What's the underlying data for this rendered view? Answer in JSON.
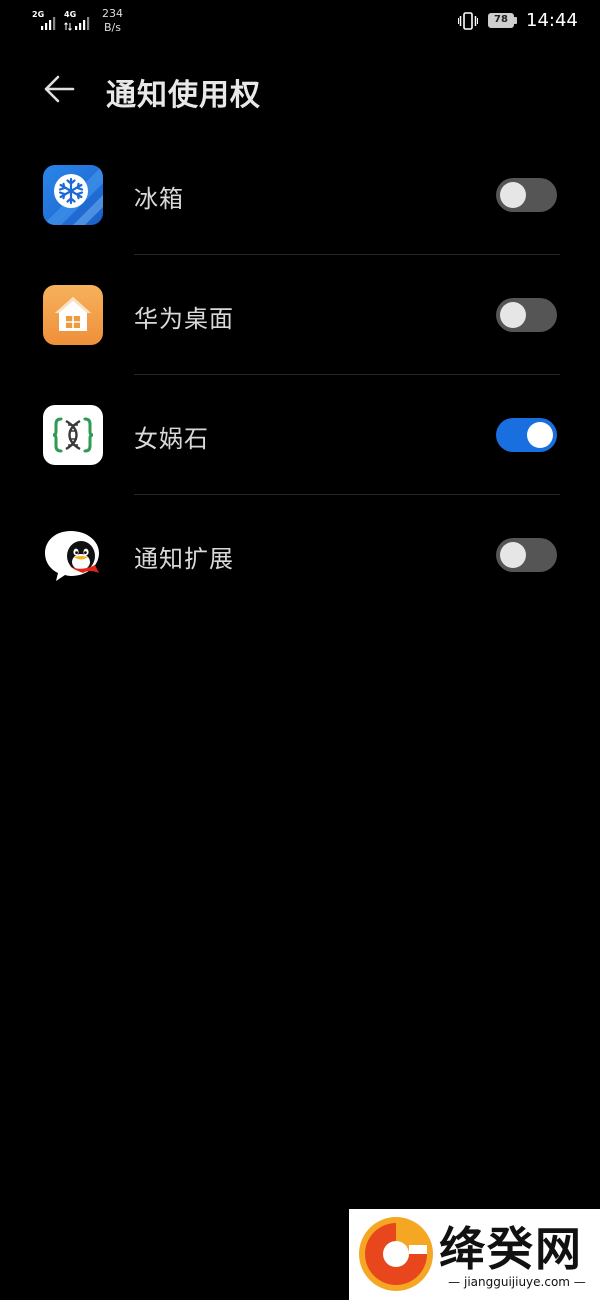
{
  "status_bar": {
    "signal_1": "2G",
    "signal_2": "4G",
    "speed_value": "234",
    "speed_unit": "B/s",
    "battery_level": "78",
    "time": "14:44"
  },
  "header": {
    "title": "通知使用权"
  },
  "apps": [
    {
      "name": "冰箱",
      "icon": "snowflake-icon",
      "enabled": false,
      "color": "#2a7de1"
    },
    {
      "name": "华为桌面",
      "icon": "house-icon",
      "enabled": false,
      "color": "#f3a14b"
    },
    {
      "name": "女娲石",
      "icon": "dna-icon",
      "enabled": true,
      "color": "#ffffff"
    },
    {
      "name": "通知扩展",
      "icon": "penguin-icon",
      "enabled": false,
      "color": "#ffffff"
    }
  ],
  "colors": {
    "toggle_on": "#1a6fe0",
    "toggle_off": "#555555",
    "background": "#000000"
  },
  "watermark": {
    "title": "绛癸网",
    "url": "— jiangguijiuye.com —"
  }
}
